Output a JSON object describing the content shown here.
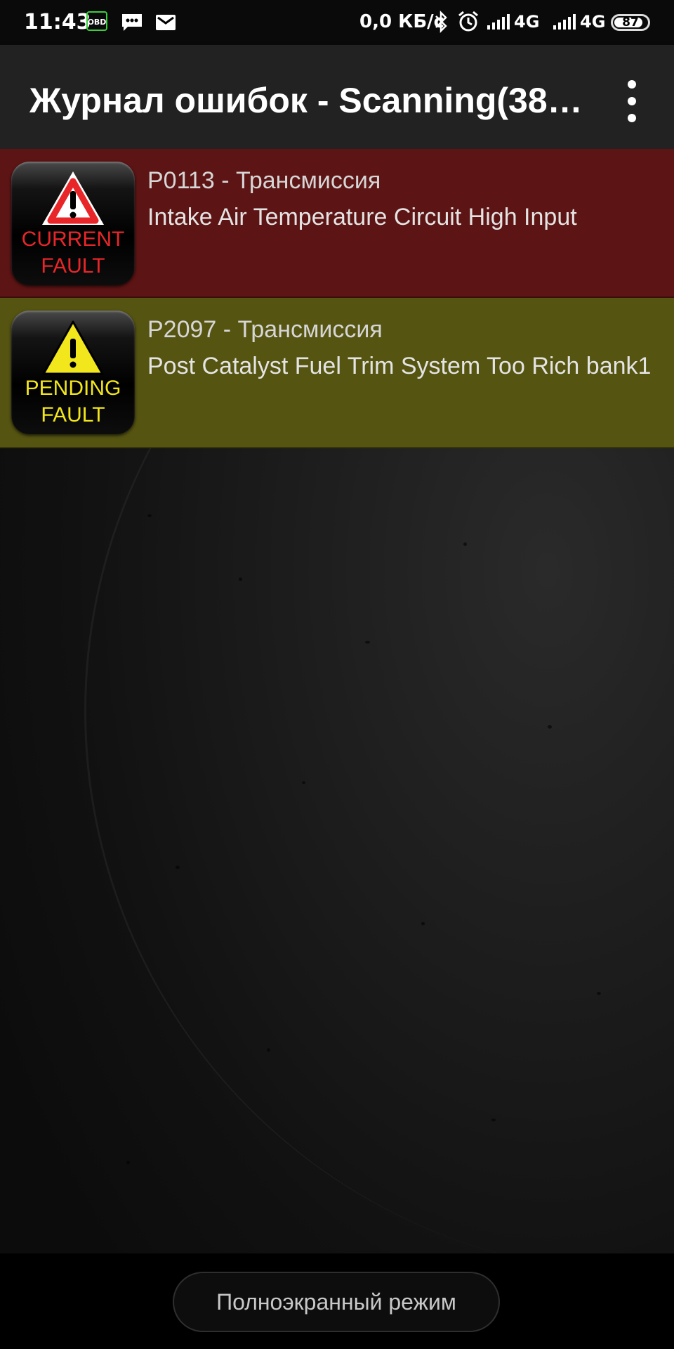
{
  "status_bar": {
    "time": "11:43",
    "obd_label": "OBD",
    "net_speed": "0,0 КБ/с",
    "network1": "4G",
    "network2": "4G",
    "battery": "87"
  },
  "app_bar": {
    "title": "Журнал ошибок - Scanning(38…"
  },
  "faults": [
    {
      "badge_line1": "CURRENT",
      "badge_line2": "FAULT",
      "code": "P0113 - Трансмиссия",
      "description": "Intake Air Temperature Circuit High Input",
      "row_color": "#5d1414",
      "badge_color": "#e8262a"
    },
    {
      "badge_line1": "PENDING",
      "badge_line2": "FAULT",
      "code": "P2097 - Трансмиссия",
      "description": "Post Catalyst Fuel Trim System Too Rich bank1",
      "row_color": "#555411",
      "badge_color": "#f2e61c"
    }
  ],
  "bottom": {
    "fullscreen_label": "Полноэкранный режим"
  }
}
